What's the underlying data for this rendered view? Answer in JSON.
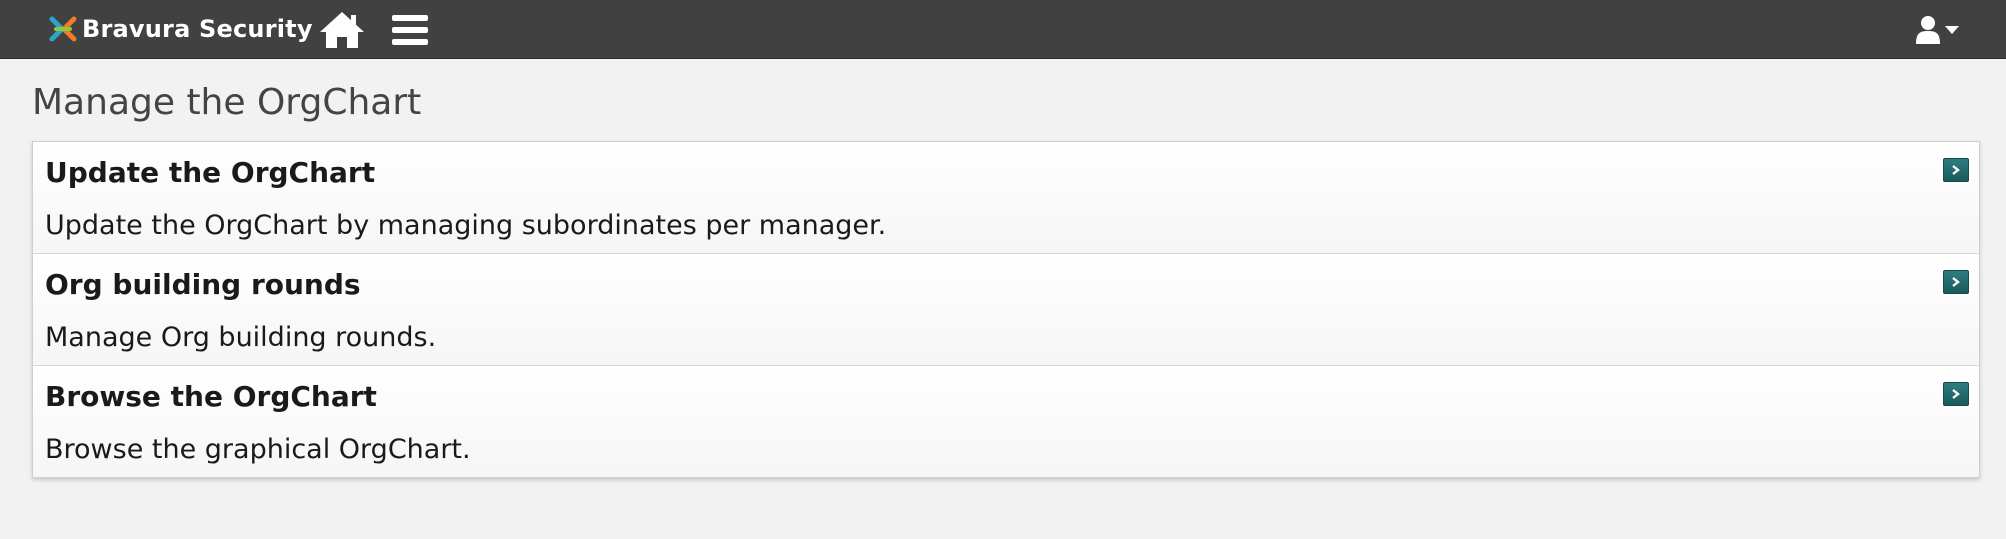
{
  "app": {
    "brand_name": "Bravura Security"
  },
  "navbar": {
    "home_icon": "home-icon",
    "menu_icon": "hamburger-menu-icon",
    "user_icon": "user-icon",
    "background_color": "#414141"
  },
  "page": {
    "title": "Manage the OrgChart"
  },
  "cards": [
    {
      "title": "Update the OrgChart",
      "description": "Update the OrgChart by managing subordinates per manager."
    },
    {
      "title": "Org building rounds",
      "description": "Manage Org building rounds."
    },
    {
      "title": "Browse the OrgChart",
      "description": "Browse the graphical OrgChart."
    }
  ],
  "colors": {
    "accent_arrow": "#1f6a6d",
    "page_background": "#f2f2f2"
  }
}
